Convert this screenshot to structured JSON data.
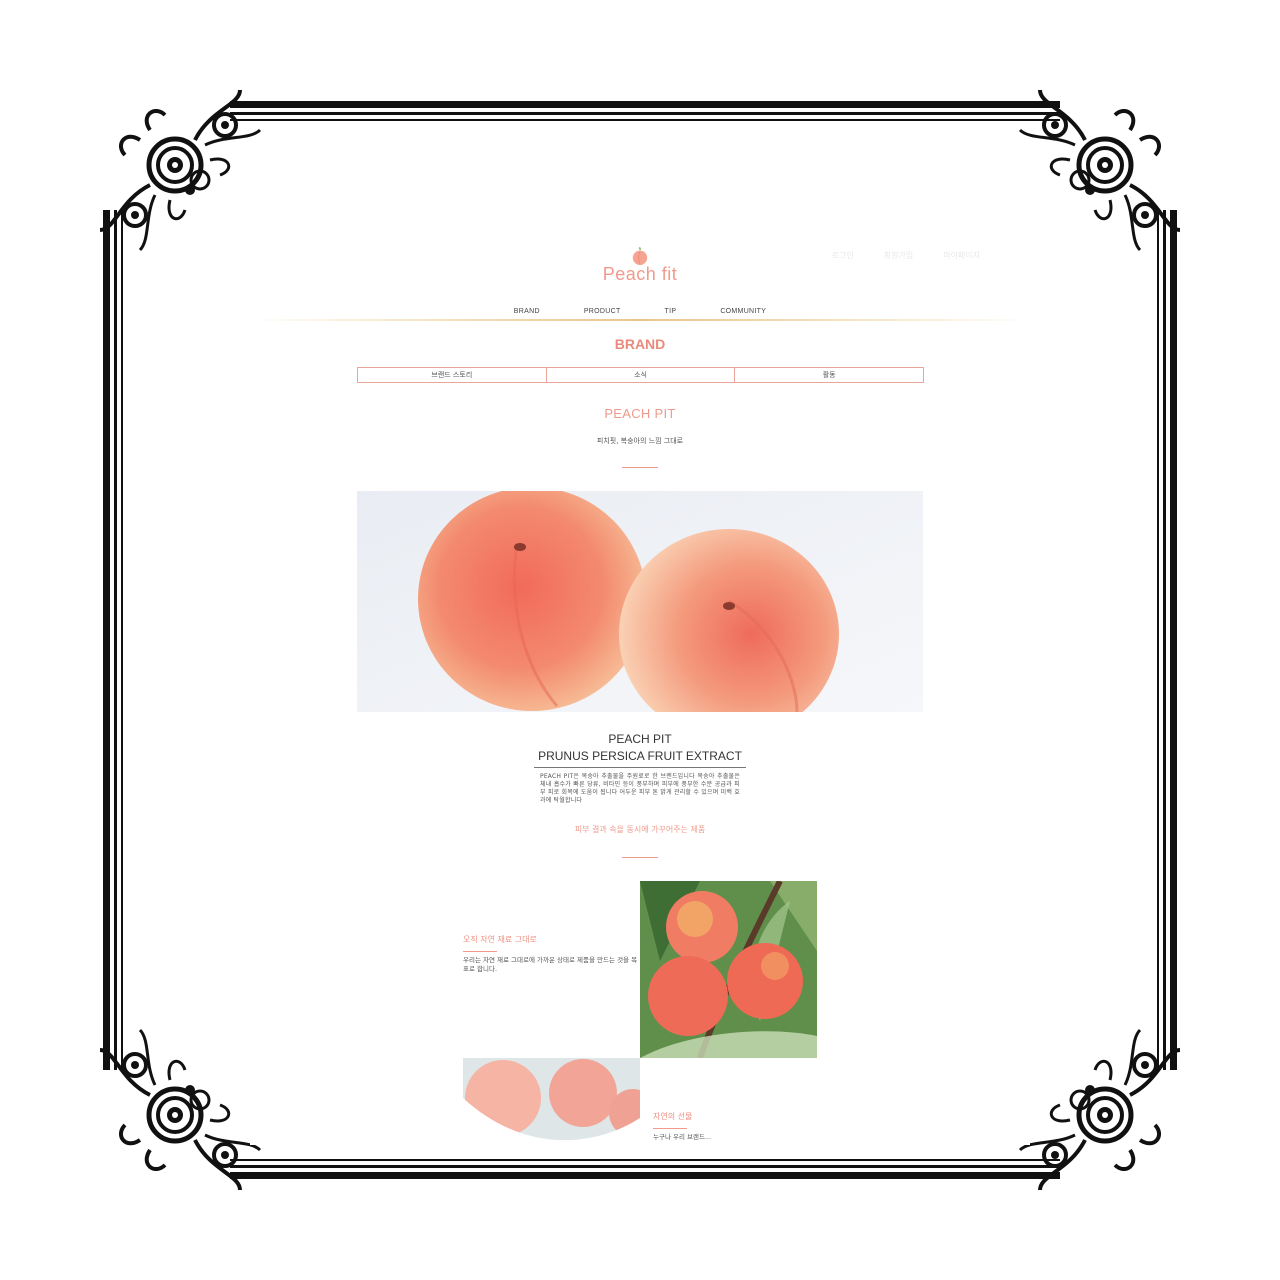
{
  "logo": {
    "text": "Peach fit"
  },
  "util_nav": [
    "로그인",
    "회원가입",
    "마이페이지"
  ],
  "gnb": [
    "BRAND",
    "PRODUCT",
    "TIP",
    "COMMUNITY"
  ],
  "section_title": "BRAND",
  "tabs": [
    "브랜드 스토리",
    "소식",
    "활동"
  ],
  "intro": {
    "title": "PEACH PIT",
    "subtitle": "피치핏, 복숭아의 느낌 그대로"
  },
  "product": {
    "title_line1": "PEACH PIT",
    "title_line2": "PRUNUS PERSICA FRUIT EXTRACT",
    "description": "PEACH PIT은 복숭아 추출물을 주원료로 한 브랜드입니다 복숭아 추출물은 체내 흡수가 빠른 당류, 비타민 등이 풍부하며 피부에 풍부한 수분 공급과 피부 피로 회복에 도움이 됩니다 어두운 피부 톤 밝게 관리할 수 있으며 미백 효과에 탁월합니다",
    "tagline": "피부 결과 속을 동시에 가꾸어주는 제품"
  },
  "features": [
    {
      "title": "오직 자연 재료 그대로",
      "text": "우리는 자연 재료 그대로에 가까운 상태로 제품을 만드는 것을 목표로 합니다."
    },
    {
      "title": "자연의 선물",
      "text": "누구나 우리 브랜드..."
    }
  ],
  "colors": {
    "accent": "#ef9a8c",
    "tab_border": "#e9a59a",
    "frame": "#111111"
  }
}
